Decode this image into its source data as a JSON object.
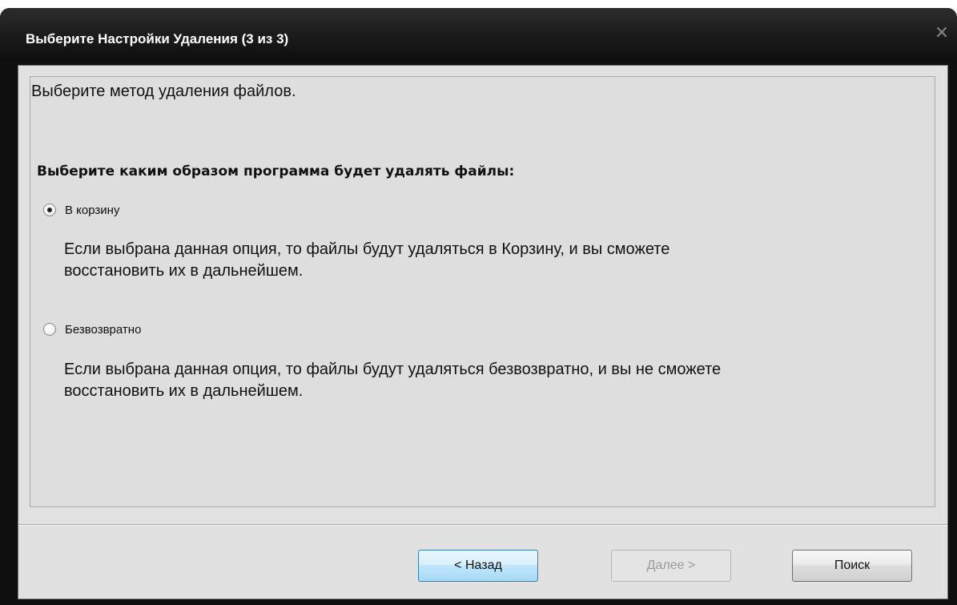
{
  "window": {
    "title": "Выберите Настройки Удаления (3 из 3)",
    "close_glyph": "×"
  },
  "main": {
    "heading": "Выберите метод удаления файлов.",
    "question": "Выберите каким образом программа будет удалять файлы:",
    "options": [
      {
        "label": "В корзину",
        "checked": true,
        "description_line1": "Если выбрана данная опция, то файлы будут удаляться в Корзину, и вы сможете",
        "description_line2": "восстановить их в дальнейшем."
      },
      {
        "label": "Безвозвратно",
        "checked": false,
        "description_line1": "Если выбрана данная опция, то файлы будут удаляться безвозвратно, и вы не сможете",
        "description_line2": "восстановить их в дальнейшем."
      }
    ]
  },
  "buttons": {
    "back": "< Назад",
    "next": "Далее >",
    "next_disabled": true,
    "search": "Поиск"
  },
  "colors": {
    "titlebar": "#1a1a1a",
    "client_bg": "#e1e1e1",
    "back_button_accent": "#a7d9f5",
    "disabled_text": "#9c9c9c"
  }
}
